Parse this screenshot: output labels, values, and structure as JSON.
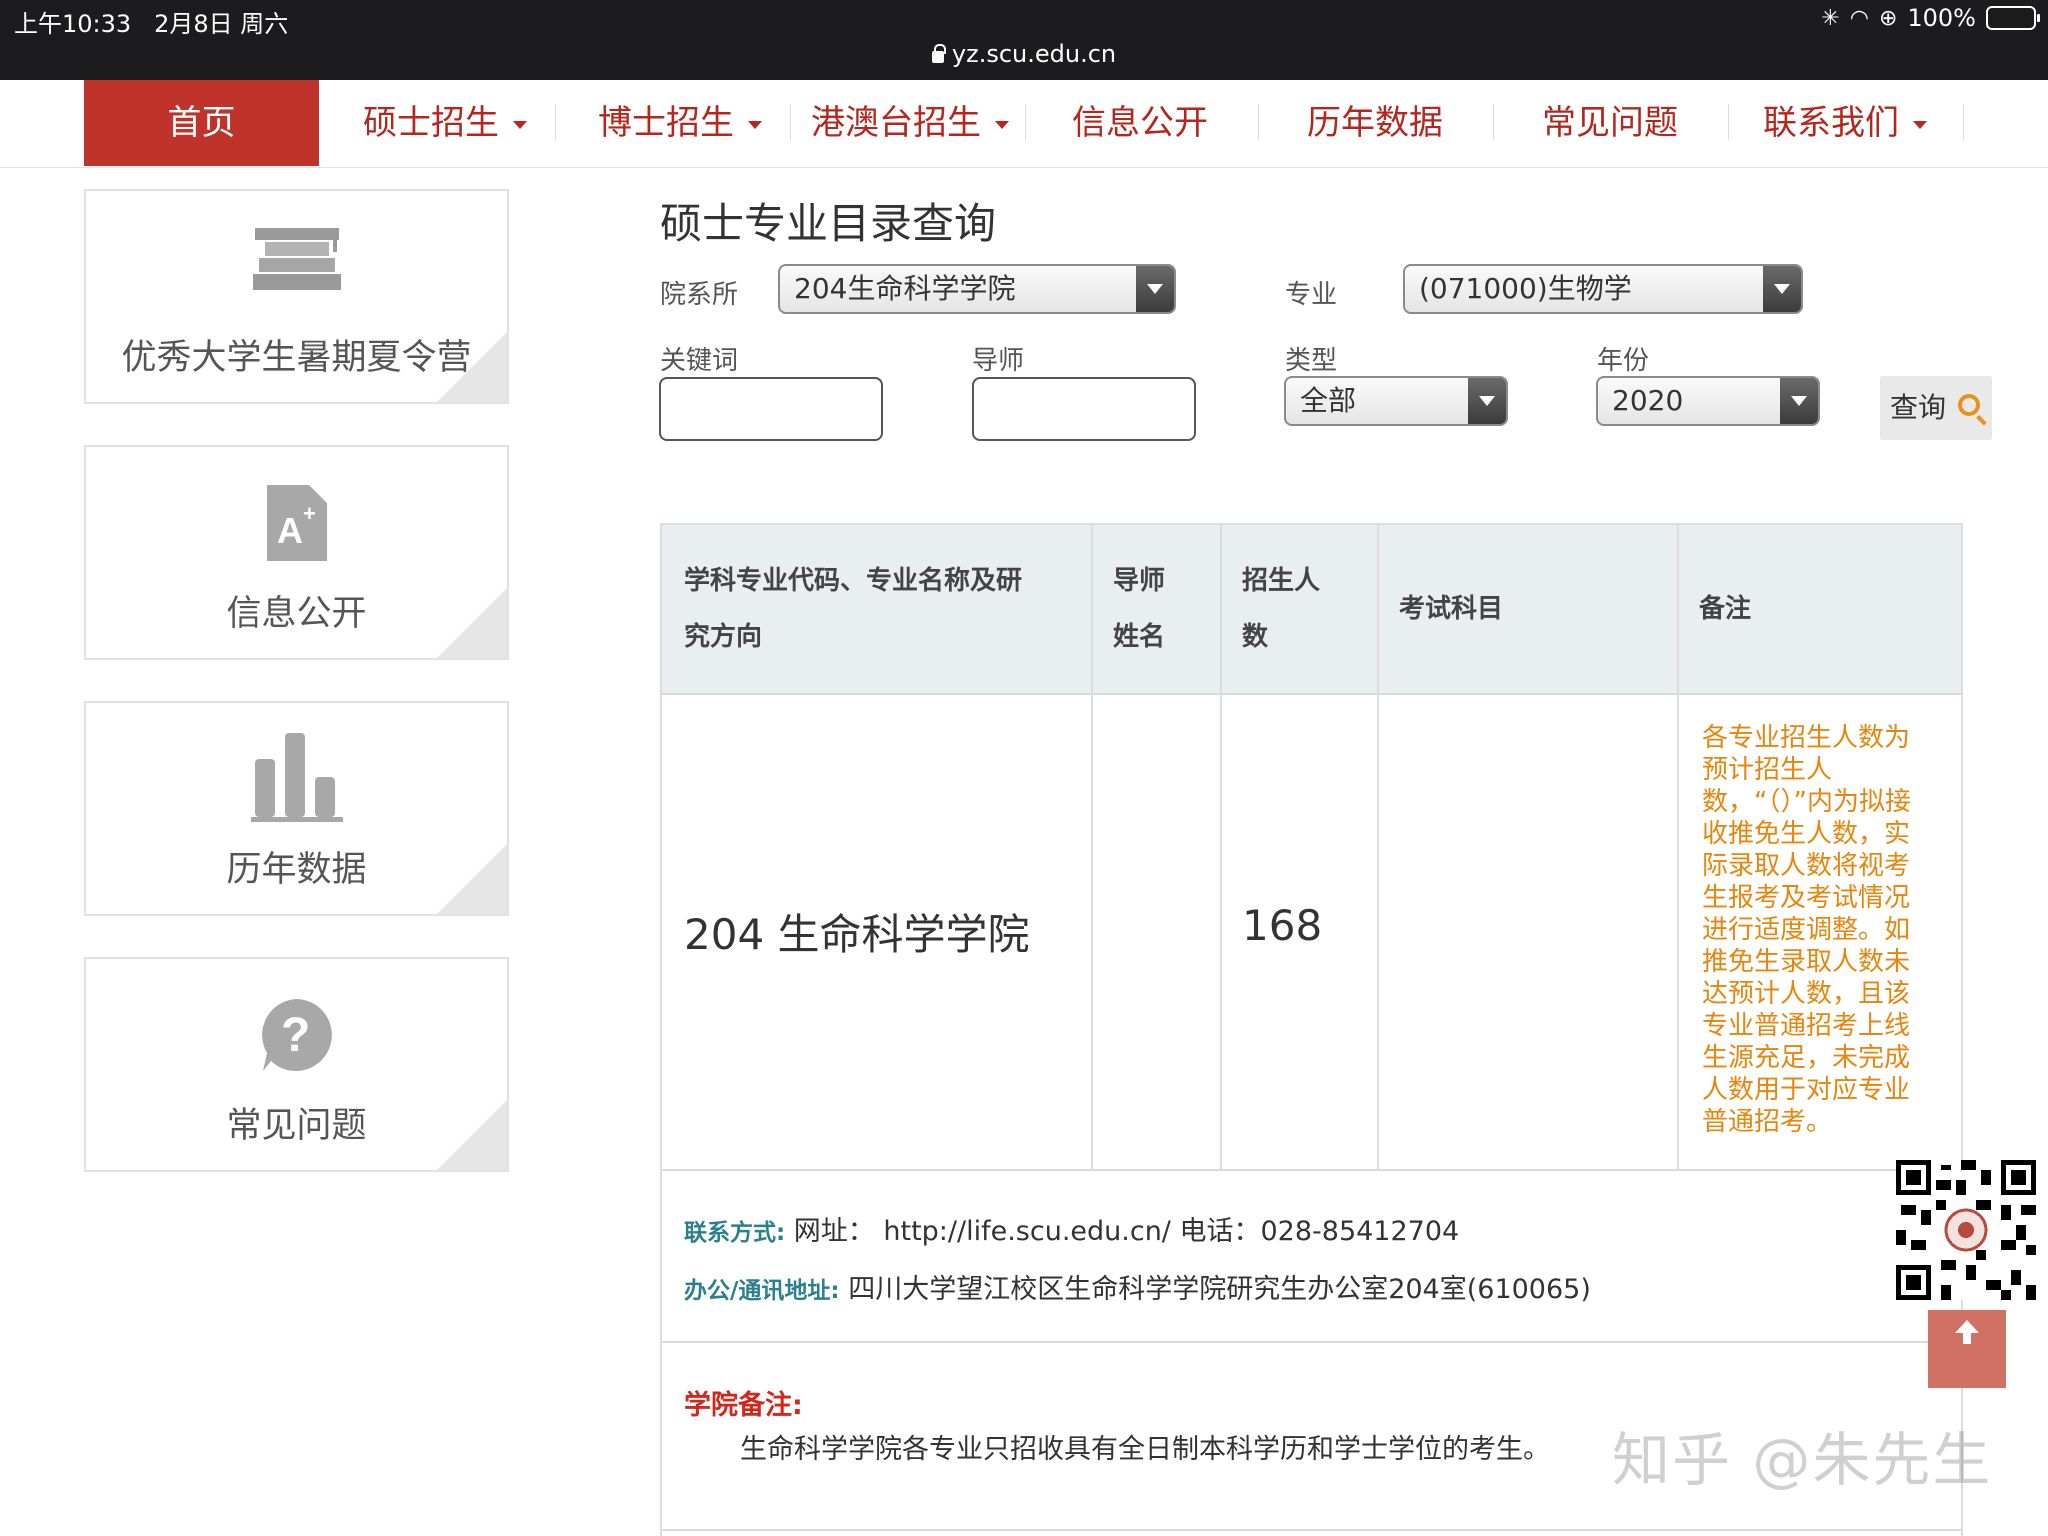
{
  "status_bar": {
    "time": "上午10:33",
    "date": "2月8日 周六",
    "battery": "100%"
  },
  "browser": {
    "url": "yz.scu.edu.cn"
  },
  "nav": {
    "items": [
      {
        "label": "首页"
      },
      {
        "label": "硕士招生"
      },
      {
        "label": "博士招生"
      },
      {
        "label": "港澳台招生"
      },
      {
        "label": "信息公开"
      },
      {
        "label": "历年数据"
      },
      {
        "label": "常见问题"
      },
      {
        "label": "联系我们"
      }
    ]
  },
  "sidebar": {
    "cards": [
      {
        "label": "优秀大学生暑期夏令营",
        "icon": "books-icon"
      },
      {
        "label": "信息公开",
        "icon": "document-aplus-icon"
      },
      {
        "label": "历年数据",
        "icon": "bar-chart-icon"
      },
      {
        "label": "常见问题",
        "icon": "question-icon"
      }
    ]
  },
  "search": {
    "title": "硕士专业目录查询",
    "department_label": "院系所",
    "department_value": "204生命科学学院",
    "major_label": "专业",
    "major_value": "(071000)生物学",
    "keyword_label": "关键词",
    "keyword_value": "",
    "advisor_label": "导师",
    "advisor_value": "",
    "type_label": "类型",
    "type_value": "全部",
    "year_label": "年份",
    "year_value": "2020",
    "submit_label": "查询"
  },
  "table": {
    "headers": {
      "major_line1": "学科专业代码、专业名称及研",
      "major_line2": "究方向",
      "advisor_line1": "导师",
      "advisor_line2": "姓名",
      "quota_line1": "招生人",
      "quota_line2": "数",
      "subjects": "考试科目",
      "remarks": "备注"
    },
    "row": {
      "department": "204 生命科学学院",
      "quota": "168",
      "note": "各专业招生人数为预计招生人数，“（）”内为拟接收推免生人数，实际录取人数将视考生报考及考试情况进行适度调整。如推免生录取人数未达预计人数，且该专业普通招考上线生源充足，未完成人数用于对应专业普通招考。"
    },
    "contact": {
      "contact_key": "联系方式:",
      "contact_value": "网址： http://life.scu.edu.cn/ 电话：028-85412704",
      "address_key": "办公/通讯地址:",
      "address_value": "四川大学望江校区生命科学学院研究生办公室204室(610065)"
    },
    "college_remark_title": "学院备注:",
    "college_remark_text": "生命科学学院各专业只招收具有全日制本科学历和学士学位的考生。"
  },
  "watermark": "知乎 @朱先生",
  "colors": {
    "nav_active": "#c0332a",
    "nav_text": "#b5261e",
    "note_orange": "#e8850d",
    "label_teal": "#2c7f8c"
  }
}
